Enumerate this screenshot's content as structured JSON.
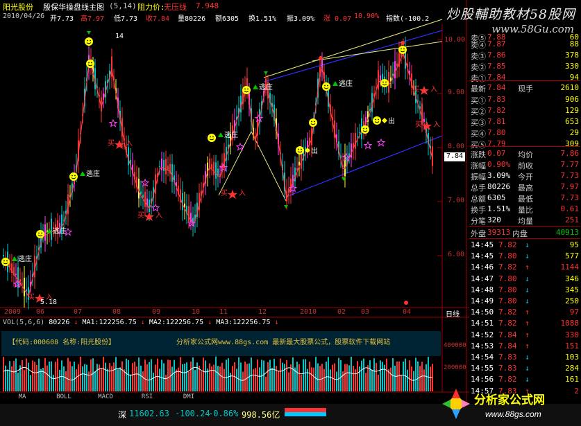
{
  "title_bar": {
    "stock_name": "阳光股份",
    "indicator_name": "殷保华操盘线主图",
    "params": "(5,14)",
    "resistance_label": "阻力价:",
    "resistance_text": "无压线",
    "resistance_value": "7.948"
  },
  "info_bar": {
    "date": "2010/04/26",
    "open": "开7.73",
    "high": "高7.97",
    "low": "低7.73",
    "close": "收7.84",
    "volume": "量80226",
    "amount": "额6305",
    "turnover": "换1.51%",
    "amplitude": "振3.09%",
    "change": "涨 0.07",
    "change_pct": "10.90%",
    "index_label": "指数(-100.2"
  },
  "watermark": {
    "title": "炒股輔助教材58股网",
    "url": "www.58Gu.com"
  },
  "price_axis": {
    "labels": [
      "10.00",
      "9.00",
      "8.00",
      "7.00",
      "6.00"
    ],
    "current_price": "7.84"
  },
  "date_axis": {
    "labels": [
      "2009",
      "06",
      "07",
      "08",
      "09",
      "10",
      "11",
      "12",
      "2010",
      "02",
      "03",
      "04"
    ],
    "daily_line": "日线"
  },
  "annotations": {
    "escape": "逃庄",
    "buy": "入",
    "out": "出",
    "buy_sell": "买",
    "low_mark": "5.18",
    "high_mark": "14"
  },
  "volume_panel": {
    "header_vol": "VOL(5,6,6)",
    "vol_value": "80226",
    "ma1": "MA1:122256.75",
    "ma2": "MA2:122256.75",
    "ma3": "MA3:122256.75",
    "code_label": "【代码:000608 名称:阳光股份】",
    "promo": "分析家公式网www.88gs.com 最新最大股票公式，股票软件下载网站",
    "axis_labels": [
      "400000",
      "200000"
    ]
  },
  "order_book": {
    "asks": [
      {
        "label": "卖⑤",
        "price": "7.88",
        "vol": "60"
      },
      {
        "label": "卖④",
        "price": "7.87",
        "vol": "88"
      },
      {
        "label": "卖③",
        "price": "7.86",
        "vol": "378"
      },
      {
        "label": "卖②",
        "price": "7.85",
        "vol": "330"
      },
      {
        "label": "卖①",
        "price": "7.84",
        "vol": "94"
      }
    ],
    "latest": {
      "label": "最新",
      "price": "7.84",
      "hand_label": "现手",
      "hand": "2610"
    },
    "bids": [
      {
        "label": "买①",
        "price": "7.83",
        "vol": "906"
      },
      {
        "label": "买②",
        "price": "7.82",
        "vol": "129"
      },
      {
        "label": "买③",
        "price": "7.81",
        "vol": "653"
      },
      {
        "label": "买④",
        "price": "7.80",
        "vol": "29"
      },
      {
        "label": "买⑤",
        "price": "7.79",
        "vol": "309"
      }
    ],
    "stats": [
      {
        "l1": "涨跌",
        "v1": "0.07",
        "l2": "均价",
        "v2": "7.86"
      },
      {
        "l1": "涨幅",
        "v1": "0.90%",
        "l2": "前收",
        "v2": "7.77"
      },
      {
        "l1": "振幅",
        "v1": "3.09%",
        "l2": "今开",
        "v2": "7.73"
      },
      {
        "l1": "总手",
        "v1": "80226",
        "l2": "最高",
        "v2": "7.97"
      },
      {
        "l1": "总额",
        "v1": "6305",
        "l2": "最低",
        "v2": "7.73"
      },
      {
        "l1": "换手",
        "v1": "1.51%",
        "l2": "量比",
        "v2": "0.61"
      },
      {
        "l1": "分笔",
        "v1": "320",
        "l2": "均量",
        "v2": "251"
      }
    ],
    "outer": {
      "l1": "外盘",
      "v1": "39313",
      "l2": "内盘",
      "v2": "40913"
    }
  },
  "ticks": [
    {
      "time": "14:45",
      "price": "7.82",
      "dir": "↓",
      "vol": "95"
    },
    {
      "time": "14:45",
      "price": "7.80",
      "dir": "↓",
      "vol": "577"
    },
    {
      "time": "14:46",
      "price": "7.82",
      "dir": "↑",
      "vol": "1144"
    },
    {
      "time": "14:47",
      "price": "7.80",
      "dir": "↓",
      "vol": "346"
    },
    {
      "time": "14:48",
      "price": "7.80",
      "dir": "↓",
      "vol": "345"
    },
    {
      "time": "14:49",
      "price": "7.80",
      "dir": "↓",
      "vol": "250"
    },
    {
      "time": "14:50",
      "price": "7.82",
      "dir": "↑",
      "vol": "97"
    },
    {
      "time": "14:51",
      "price": "7.82",
      "dir": "↑",
      "vol": "1088"
    },
    {
      "time": "14:52",
      "price": "7.84",
      "dir": "↑",
      "vol": "330"
    },
    {
      "time": "14:53",
      "price": "7.84",
      "dir": "↑",
      "vol": "151"
    },
    {
      "time": "14:54",
      "price": "7.83",
      "dir": "↓",
      "vol": "103"
    },
    {
      "time": "14:55",
      "price": "7.83",
      "dir": "↓",
      "vol": "284"
    },
    {
      "time": "14:56",
      "price": "7.82",
      "dir": "↓",
      "vol": "161"
    },
    {
      "time": "14:57",
      "price": "7.83",
      "dir": "↑",
      "vol": "2"
    }
  ],
  "tabs": [
    "MA",
    "BOLL",
    "MACD",
    "RSI",
    "DMI"
  ],
  "status_bar": {
    "market": "深",
    "index": "11602.63",
    "change": "-100.24",
    "pct": "-0.86%",
    "amount": "998.56亿"
  },
  "logo": {
    "text": "分析家公式网",
    "url": "www.88gs.com"
  },
  "colors": {
    "up": "#ff3232",
    "down": "#00c8c8",
    "yellow": "#ffff00",
    "green": "#00c000",
    "axis": "#a00000"
  }
}
